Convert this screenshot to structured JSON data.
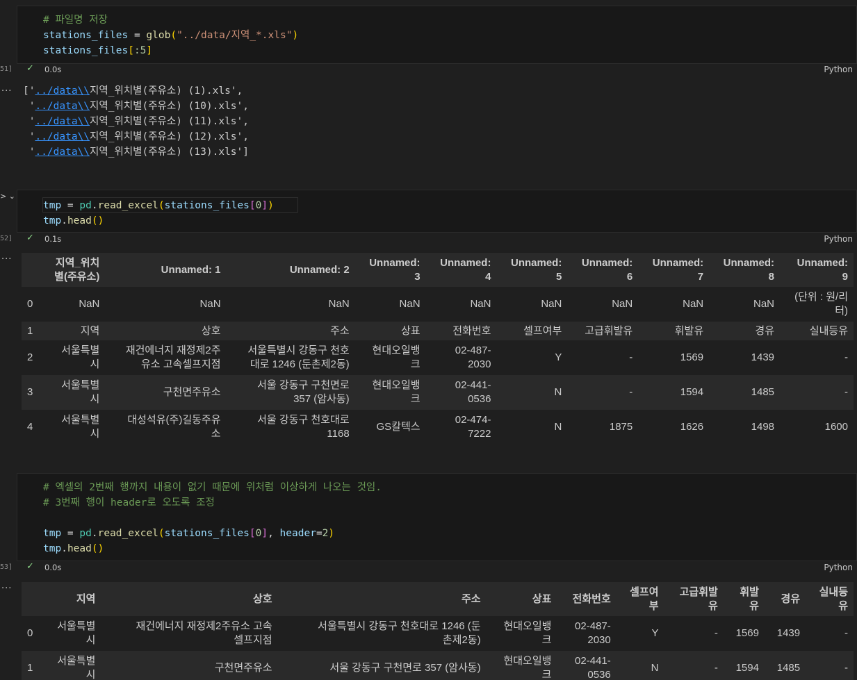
{
  "cell1": {
    "exec": "51]",
    "comment": "# 파일명 저장",
    "line2": {
      "var": "stations_files",
      "op": " = ",
      "fn": "glob",
      "arg": "\"../data/지역_*.xls\""
    },
    "line3": {
      "var": "stations_files",
      "slice_open": "[",
      "slice": ":5",
      "slice_close": "]"
    },
    "time": "0.0s",
    "lang": "Python"
  },
  "output1": {
    "lines": [
      {
        "pre": "['",
        "link": "../data\\\\",
        "post": "지역_위치별(주유소) (1).xls',"
      },
      {
        "pre": " '",
        "link": "../data\\\\",
        "post": "지역_위치별(주유소) (10).xls',"
      },
      {
        "pre": " '",
        "link": "../data\\\\",
        "post": "지역_위치별(주유소) (11).xls',"
      },
      {
        "pre": " '",
        "link": "../data\\\\",
        "post": "지역_위치별(주유소) (12).xls',"
      },
      {
        "pre": " '",
        "link": "../data\\\\",
        "post": "지역_위치별(주유소) (13).xls']"
      }
    ]
  },
  "cell2": {
    "exec": "52]",
    "line1": {
      "var": "tmp",
      "mod": "pd",
      "fn": "read_excel",
      "argvar": "stations_files",
      "idx": "0"
    },
    "line2": {
      "var": "tmp",
      "fn": "head"
    },
    "time": "0.1s",
    "lang": "Python"
  },
  "table1": {
    "headers": [
      "",
      "지역_위치\n별(주유소)",
      "Unnamed: 1",
      "Unnamed: 2",
      "Unnamed:\n3",
      "Unnamed:\n4",
      "Unnamed:\n5",
      "Unnamed:\n6",
      "Unnamed:\n7",
      "Unnamed:\n8",
      "Unnamed:\n9"
    ],
    "rows": [
      [
        "0",
        "NaN",
        "NaN",
        "NaN",
        "NaN",
        "NaN",
        "NaN",
        "NaN",
        "NaN",
        "NaN",
        "(단위 : 원/리\n터)"
      ],
      [
        "1",
        "지역",
        "상호",
        "주소",
        "상표",
        "전화번호",
        "셀프여부",
        "고급휘발유",
        "휘발유",
        "경유",
        "실내등유"
      ],
      [
        "2",
        "서울특별\n시",
        "재건에너지 재정제2주\n유소 고속셀프지점",
        "서울특별시 강동구 천호\n대로 1246 (둔촌제2동)",
        "현대오일뱅\n크",
        "02-487-\n2030",
        "Y",
        "-",
        "1569",
        "1439",
        "-"
      ],
      [
        "3",
        "서울특별\n시",
        "구천면주유소",
        "서울 강동구 구천면로\n357 (암사동)",
        "현대오일뱅\n크",
        "02-441-\n0536",
        "N",
        "-",
        "1594",
        "1485",
        "-"
      ],
      [
        "4",
        "서울특별\n시",
        "대성석유(주)길동주유\n소",
        "서울 강동구 천호대로\n1168",
        "GS칼텍스",
        "02-474-\n7222",
        "N",
        "1875",
        "1626",
        "1498",
        "1600"
      ]
    ]
  },
  "cell3": {
    "exec": "53]",
    "comment1": "# 엑셀의 2번째 행까지 내용이 없기 때문에 위처럼 이상하게 나오는 것임.",
    "comment2": "# 3번째 행이 header로 오도록 조정",
    "line1": {
      "var": "tmp",
      "mod": "pd",
      "fn": "read_excel",
      "argvar": "stations_files",
      "idx": "0",
      "kw": "header",
      "kwval": "2"
    },
    "line2": {
      "var": "tmp",
      "fn": "head"
    },
    "time": "0.0s",
    "lang": "Python"
  },
  "table2": {
    "headers": [
      "",
      "지역",
      "상호",
      "주소",
      "상표",
      "전화번호",
      "셀프여\n부",
      "고급휘발\n유",
      "휘발\n유",
      "경유",
      "실내등\n유"
    ],
    "rows": [
      [
        "0",
        "서울특별\n시",
        "재건에너지 재정제2주유소 고속\n셀프지점",
        "서울특별시 강동구 천호대로 1246 (둔\n촌제2동)",
        "현대오일뱅\n크",
        "02-487-\n2030",
        "Y",
        "-",
        "1569",
        "1439",
        "-"
      ],
      [
        "1",
        "서울특별\n시",
        "구천면주유소",
        "서울 강동구 구천면로 357 (암사동)",
        "현대오일뱅\n크",
        "02-441-\n0536",
        "N",
        "-",
        "1594",
        "1485",
        "-"
      ]
    ]
  },
  "ellipsis": "..."
}
